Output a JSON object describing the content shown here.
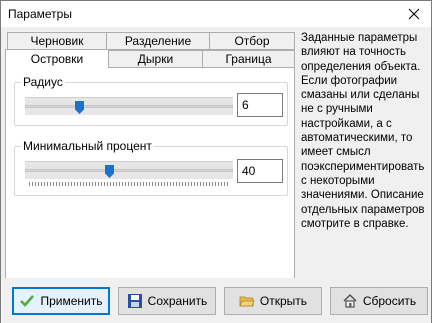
{
  "window": {
    "title": "Параметры"
  },
  "tabs": {
    "row_back": [
      "Черновик",
      "Разделение",
      "Отбор"
    ],
    "row_front": [
      "Островки",
      "Дырки",
      "Граница"
    ],
    "active": "Островки"
  },
  "radius": {
    "label": "Радиус",
    "value": "6",
    "slider_fraction": 0.25
  },
  "min_percent": {
    "label": "Минимальный процент",
    "value": "40",
    "slider_fraction": 0.4
  },
  "description": "Заданные параметры влияют на точность определения объекта. Если фотографии смазаны или сделаны не с ручными настройками, а с автоматическими, то имеет смысл поэкспериментировать с некоторыми значениями. Описание отдельных параметров смотрите в справке.",
  "buttons": {
    "apply": "Применить",
    "save": "Сохранить",
    "open": "Открыть",
    "reset": "Сбросить"
  },
  "colors": {
    "accent": "#0078d7",
    "thumb": "#1a72cc"
  }
}
